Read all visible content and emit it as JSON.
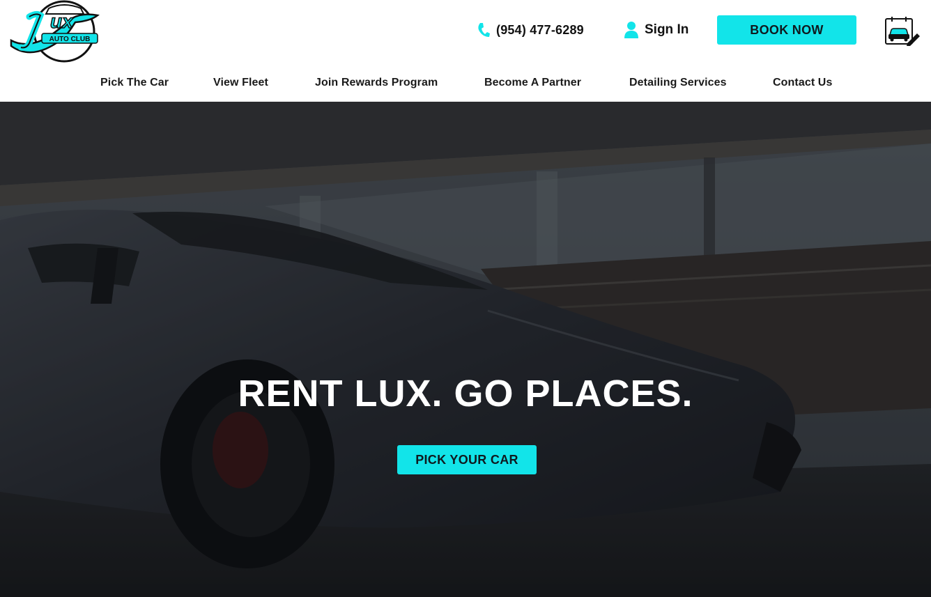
{
  "header": {
    "logo": {
      "text": "LUX",
      "subtext": "AUTO CLUB",
      "icon": "lux-auto-club-logo"
    },
    "phone": {
      "icon": "phone-icon",
      "number": "(954) 477-6289"
    },
    "sign_in": {
      "icon": "user-icon",
      "label": "Sign In"
    },
    "book_now_label": "BOOK NOW",
    "booking_icon": "car-booking-icon"
  },
  "nav": {
    "items": [
      {
        "label": "Pick The Car"
      },
      {
        "label": "View Fleet"
      },
      {
        "label": "Join Rewards Program"
      },
      {
        "label": "Become A Partner"
      },
      {
        "label": "Detailing Services"
      },
      {
        "label": "Contact Us"
      }
    ]
  },
  "hero": {
    "title": "RENT LUX. GO PLACES.",
    "cta_label": "PICK YOUR CAR"
  },
  "colors": {
    "accent": "#12e4e9",
    "text_dark": "#111111",
    "hero_text": "#ffffff"
  }
}
